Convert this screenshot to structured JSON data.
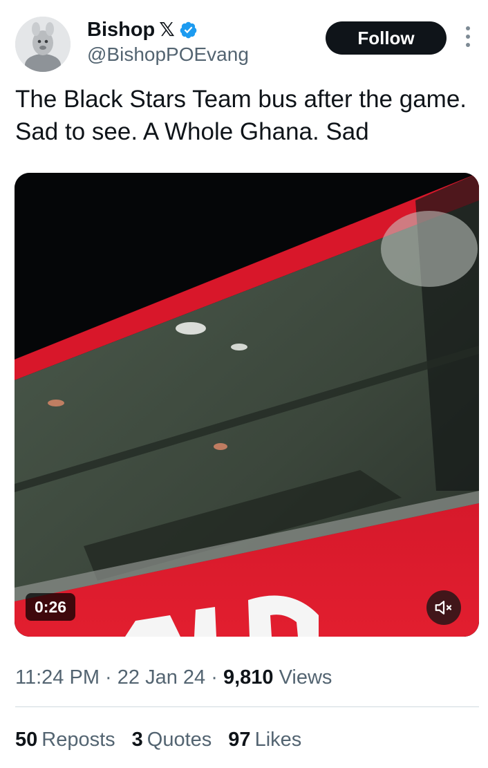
{
  "author": {
    "display_name": "Bishop",
    "x_glyph": "𝕏",
    "handle": "@BishopPOEvang"
  },
  "follow_label": "Follow",
  "tweet": {
    "text": "The Black Stars Team bus after the game. Sad to see. A Whole Ghana. Sad"
  },
  "video": {
    "duration": "0:26",
    "muted": true
  },
  "meta": {
    "time": "11:24 PM",
    "sep1": " · ",
    "date": "22 Jan 24",
    "sep2": " · ",
    "views_count": "9,810",
    "views_label": "Views"
  },
  "stats": {
    "reposts_count": "50",
    "reposts_label": "Reposts",
    "quotes_count": "3",
    "quotes_label": "Quotes",
    "likes_count": "97",
    "likes_label": "Likes"
  },
  "colors": {
    "verified": "#1d9bf0",
    "follow_bg": "#0f1419",
    "secondary_text": "#536471",
    "divider": "#cfd9de"
  }
}
